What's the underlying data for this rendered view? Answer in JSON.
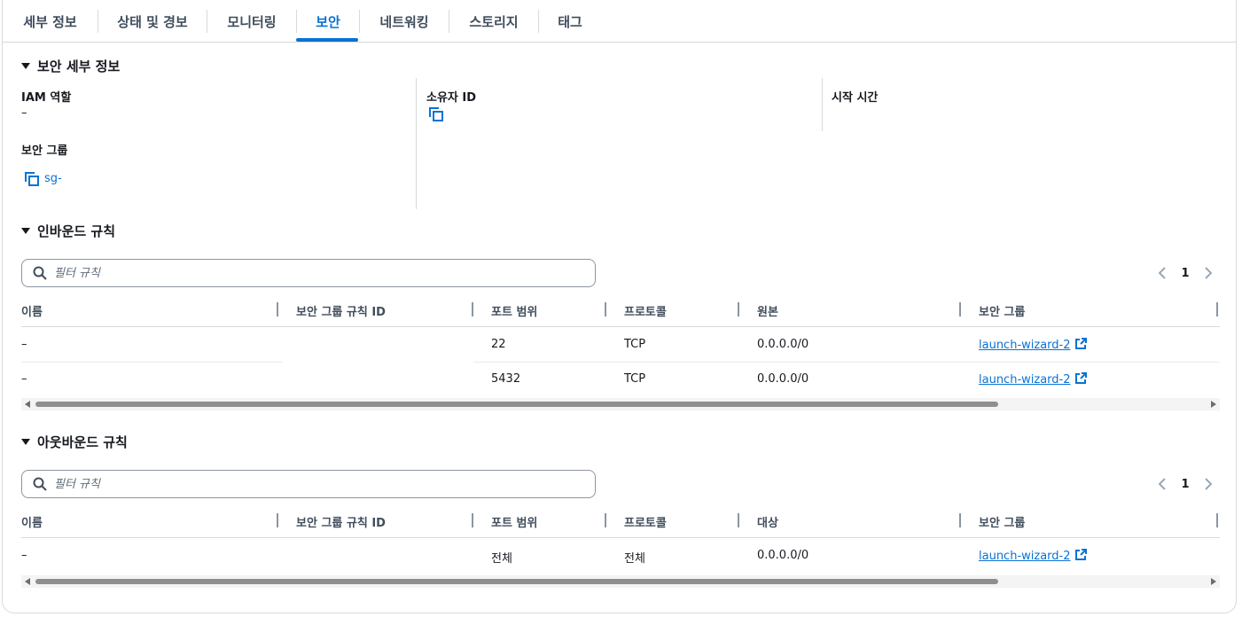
{
  "tabs": [
    {
      "label": "세부 정보"
    },
    {
      "label": "상태 및 경보"
    },
    {
      "label": "모니터링"
    },
    {
      "label": "보안"
    },
    {
      "label": "네트워킹"
    },
    {
      "label": "스토리지"
    },
    {
      "label": "태그"
    }
  ],
  "active_tab": "보안",
  "security_details": {
    "title": "보안 세부 정보",
    "iam_role_label": "IAM 역할",
    "iam_role_value": "–",
    "owner_id_label": "소유자 ID",
    "launch_time_label": "시작 시간",
    "security_group_label": "보안 그룹",
    "security_group_value": "sg-"
  },
  "inbound": {
    "title": "인바운드 규칙",
    "search_placeholder": "필터 규칙",
    "page": "1",
    "columns": [
      "이름",
      "보안 그룹 규칙 ID",
      "포트 범위",
      "프로토콜",
      "원본",
      "보안 그룹"
    ],
    "rows": [
      {
        "name": "–",
        "rule_id": "",
        "port": "22",
        "protocol": "TCP",
        "source": "0.0.0.0/0",
        "sg": "launch-wizard-2"
      },
      {
        "name": "–",
        "rule_id": "",
        "port": "5432",
        "protocol": "TCP",
        "source": "0.0.0.0/0",
        "sg": "launch-wizard-2"
      }
    ]
  },
  "outbound": {
    "title": "아웃바운드 규칙",
    "search_placeholder": "필터 규칙",
    "page": "1",
    "columns": [
      "이름",
      "보안 그룹 규칙 ID",
      "포트 범위",
      "프로토콜",
      "대상",
      "보안 그룹"
    ],
    "rows": [
      {
        "name": "–",
        "rule_id": "",
        "port": "전체",
        "protocol": "전체",
        "dest": "0.0.0.0/0",
        "sg": "launch-wizard-2"
      }
    ]
  },
  "colors": {
    "accent": "#0972d3",
    "text": "#16191f",
    "border": "#d5dbdb"
  }
}
